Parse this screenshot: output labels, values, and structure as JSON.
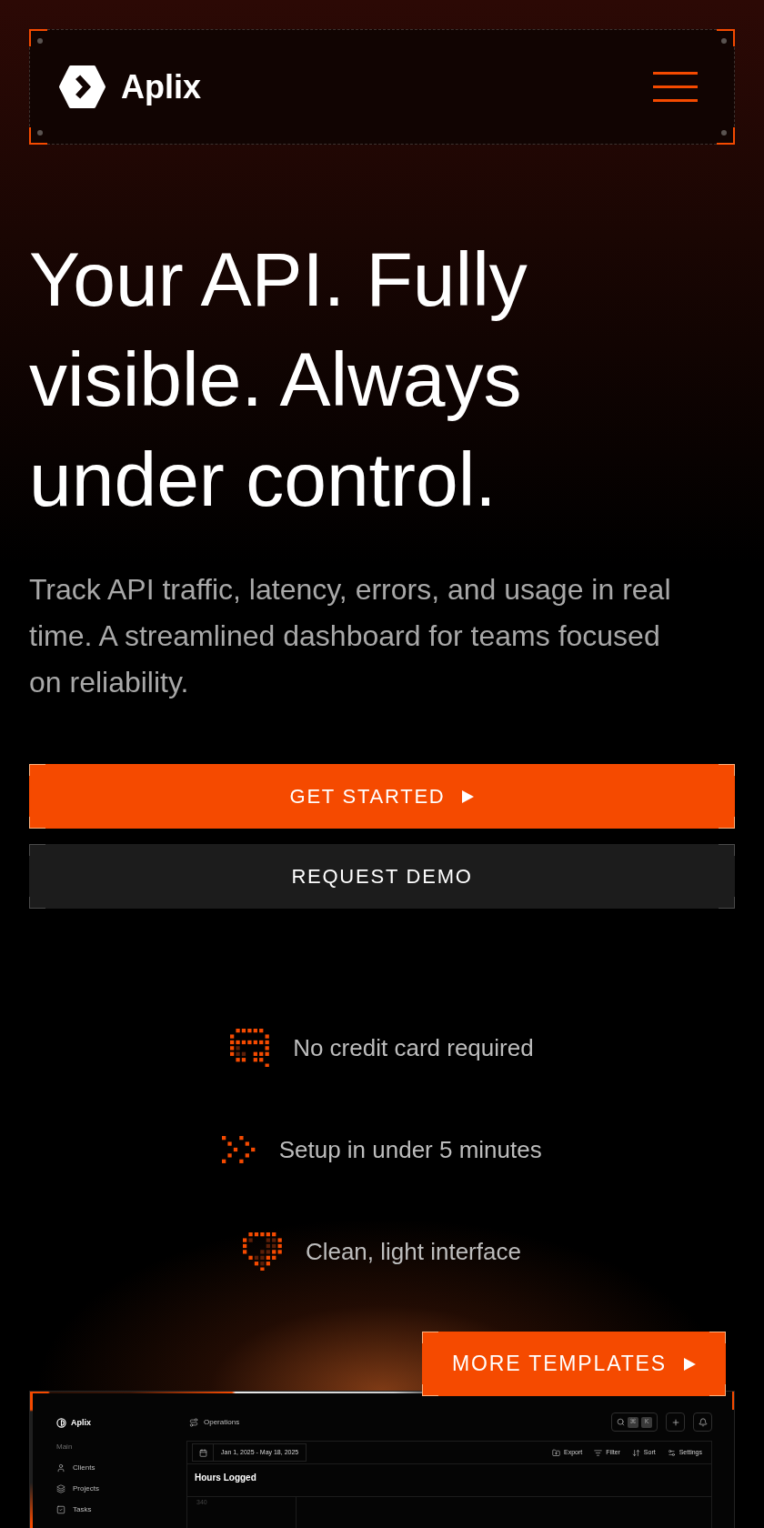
{
  "header": {
    "brand": "Aplix"
  },
  "hero": {
    "title": "Your API. Fully visible. Always under control.",
    "subtitle": "Track API traffic, latency, errors, and usage in real time. A streamlined dashboard for teams focused on reliability."
  },
  "actions": [
    {
      "label": "GET STARTED",
      "kind": "primary"
    },
    {
      "label": "REQUEST DEMO",
      "kind": "secondary"
    }
  ],
  "features": [
    {
      "text": "No credit card required",
      "kind": "card"
    },
    {
      "text": "Setup in under 5 minutes",
      "kind": "speed"
    },
    {
      "text": "Clean, light interface",
      "kind": "shield"
    }
  ],
  "templates_button": {
    "label": "MORE TEMPLATES",
    "kind": "primary"
  },
  "dashboard_preview": {
    "brand": "Aplix",
    "sidebar": {
      "section": "Main",
      "items": [
        {
          "label": "Clients",
          "kind": "user"
        },
        {
          "label": "Projects",
          "kind": "layers"
        },
        {
          "label": "Tasks",
          "kind": "check"
        }
      ]
    },
    "breadcrumb": "Operations",
    "search_keys": [
      "⌘",
      "K"
    ],
    "date_range": "Jan 1, 2025 - May 18, 2025",
    "toolbar": [
      {
        "label": "Export",
        "kind": "export"
      },
      {
        "label": "Filter",
        "kind": "filter"
      },
      {
        "label": "Sort",
        "kind": "sort"
      },
      {
        "label": "Settings",
        "kind": "settings"
      }
    ],
    "chart": {
      "title": "Hours Logged",
      "axis_label": "340"
    }
  }
}
